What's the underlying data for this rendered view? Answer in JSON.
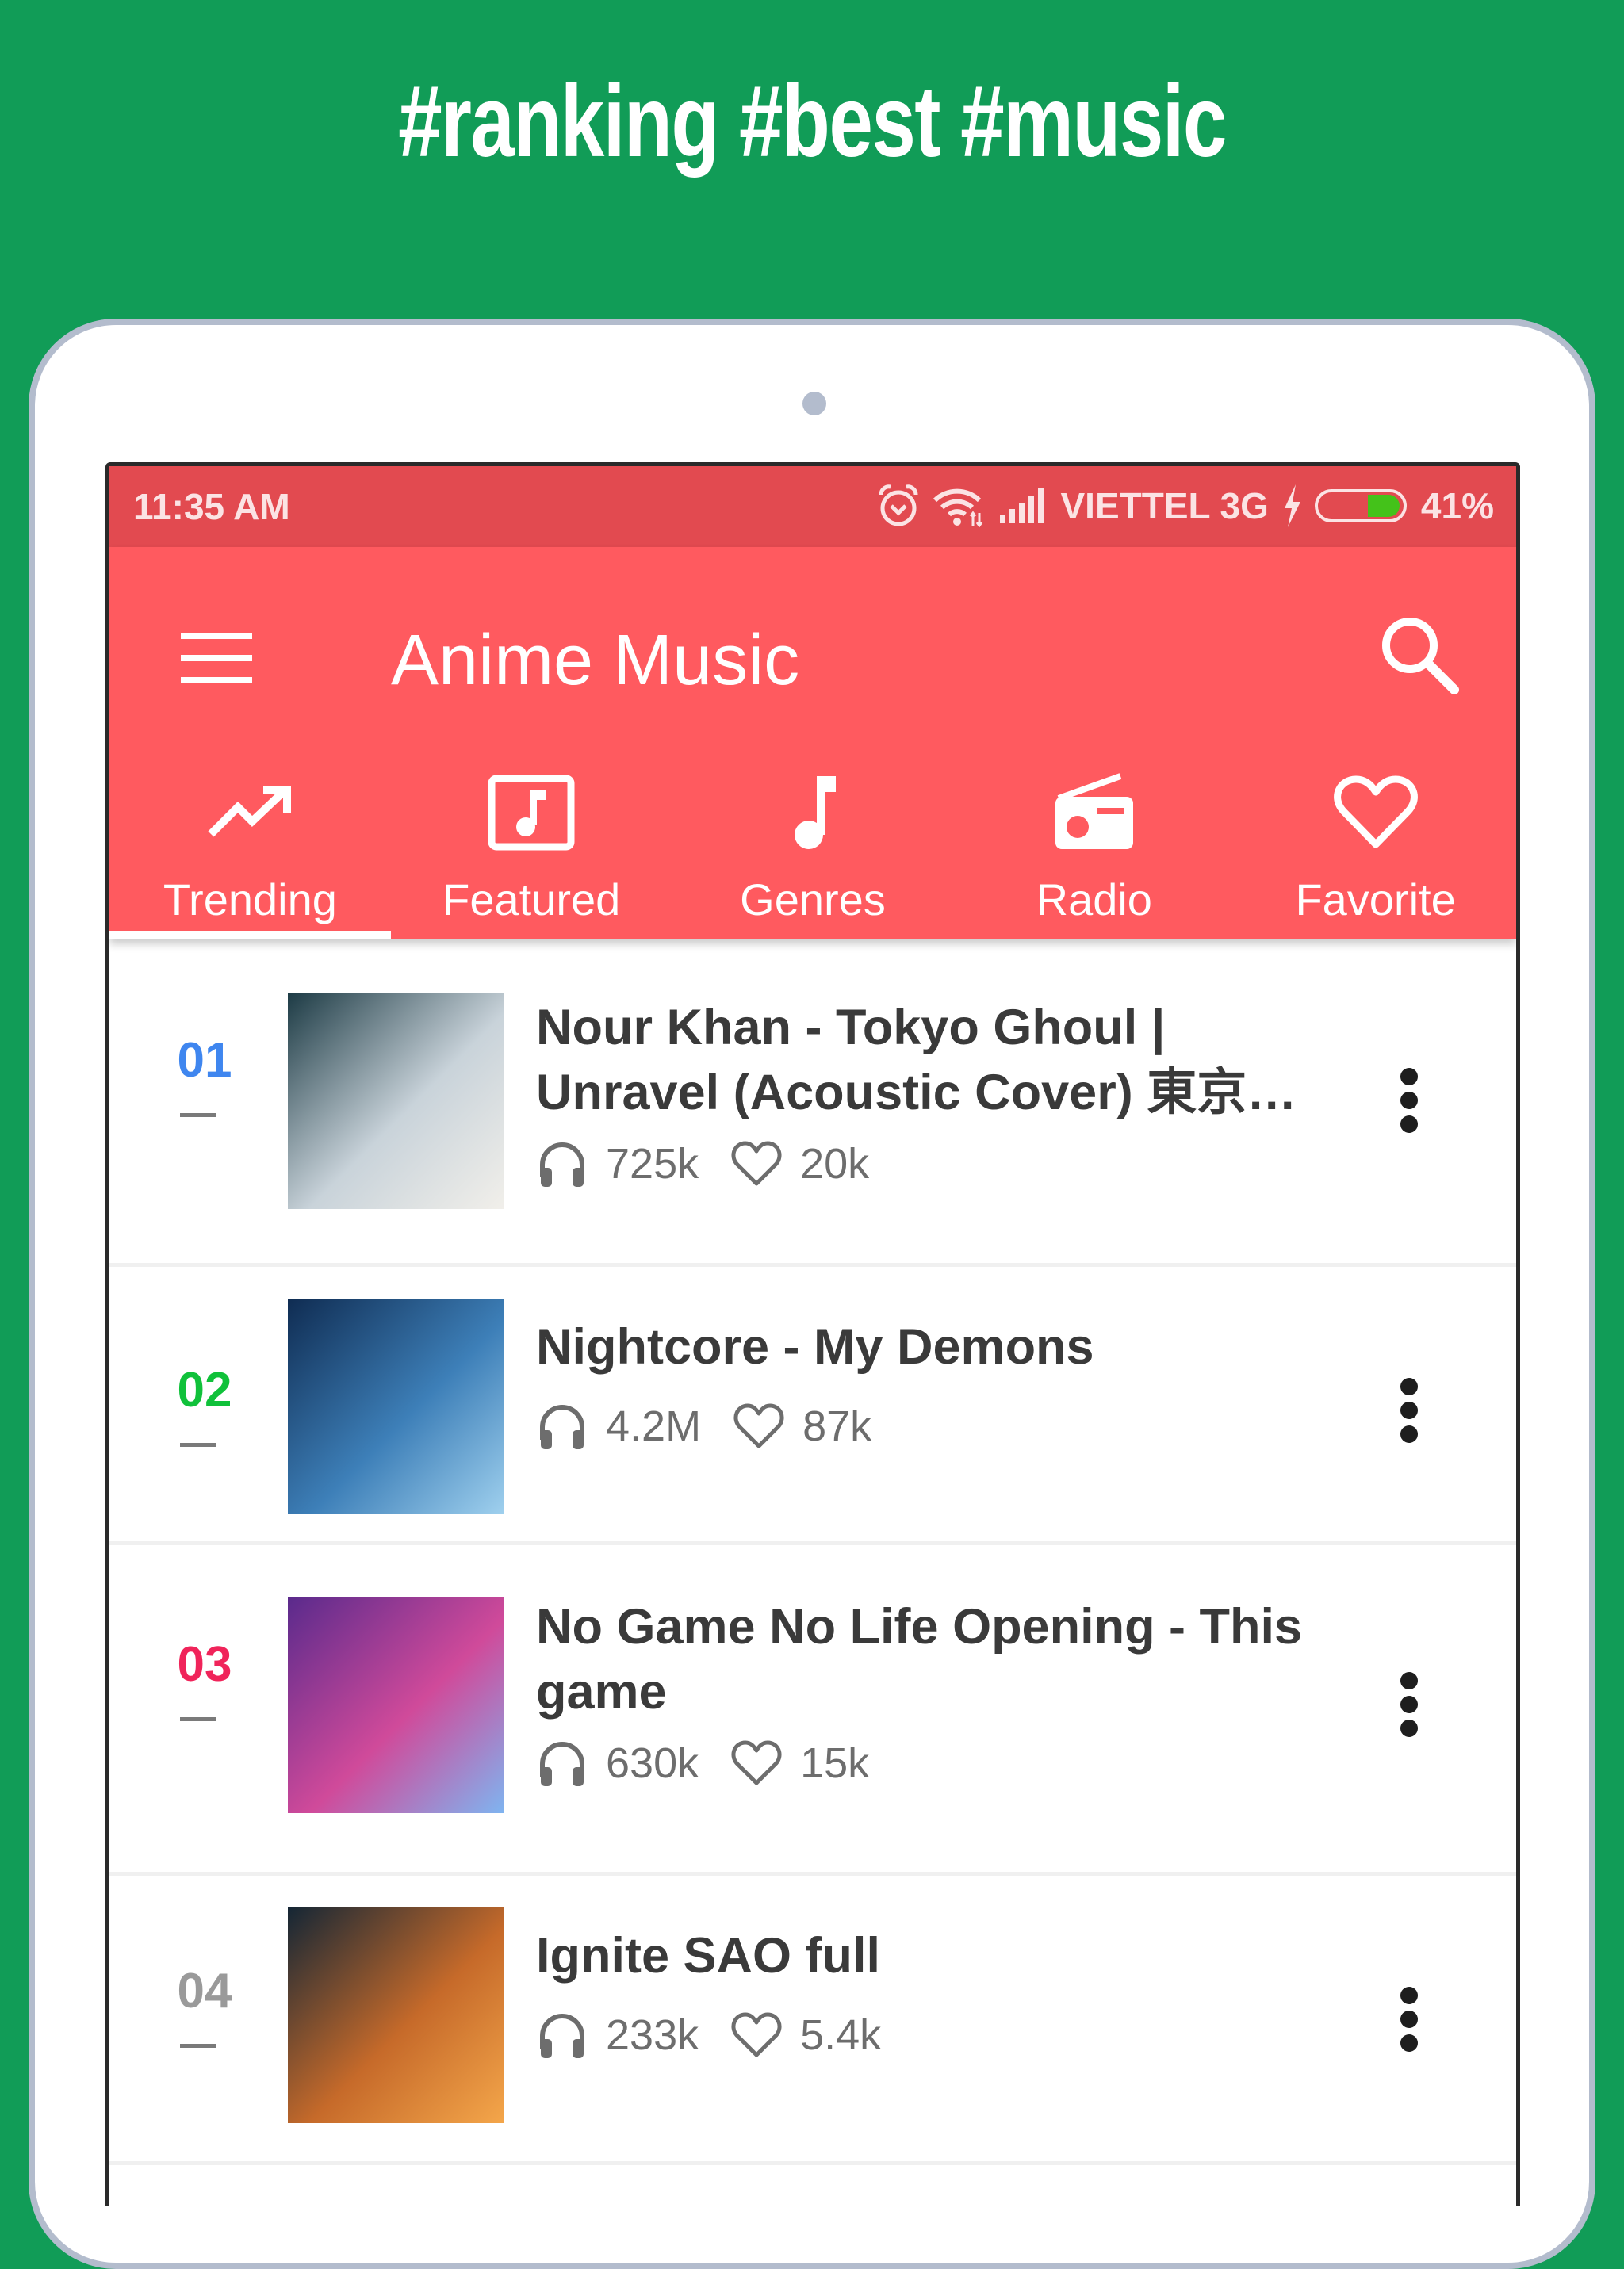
{
  "headline": "#ranking #best #music",
  "status_bar": {
    "time": "11:35 AM",
    "carrier": "VIETTEL 3G",
    "battery_percent": "41%",
    "battery_level": 0.41,
    "icons": [
      "alarm-icon",
      "wifi-icon",
      "signal-icon",
      "charging-icon",
      "battery-icon"
    ]
  },
  "app_bar": {
    "title": "Anime Music",
    "menu_icon": "hamburger-menu-icon",
    "search_icon": "search-icon"
  },
  "tabs": [
    {
      "label": "Trending",
      "icon": "trending-up-icon",
      "active": true
    },
    {
      "label": "Featured",
      "icon": "music-box-icon",
      "active": false
    },
    {
      "label": "Genres",
      "icon": "music-note-icon",
      "active": false
    },
    {
      "label": "Radio",
      "icon": "radio-icon",
      "active": false
    },
    {
      "label": "Favorite",
      "icon": "heart-outline-icon",
      "active": false
    }
  ],
  "songs": [
    {
      "rank": "01",
      "rank_color": "#3f86ef",
      "title": "Nour Khan - Tokyo Ghoul | Unravel (Acoustic Cover) 東京…",
      "plays": "725k",
      "likes": "20k",
      "thumb_colors": [
        "#1d3b45",
        "#c9d3da",
        "#f1efea"
      ]
    },
    {
      "rank": "02",
      "rank_color": "#10c13a",
      "title": "Nightcore - My Demons",
      "plays": "4.2M",
      "likes": "87k",
      "thumb_colors": [
        "#0f2c52",
        "#3d7fb8",
        "#9fd0ee"
      ]
    },
    {
      "rank": "03",
      "rank_color": "#f0245a",
      "title": "No Game No Life Opening - This game",
      "plays": "630k",
      "likes": "15k",
      "thumb_colors": [
        "#5a2a8c",
        "#d04a9a",
        "#7fb4f0"
      ]
    },
    {
      "rank": "04",
      "rank_color": "#9a9a9a",
      "title": "Ignite SAO full",
      "plays": "233k",
      "likes": "5.4k",
      "thumb_colors": [
        "#142635",
        "#c66a2a",
        "#f4a64a"
      ]
    }
  ],
  "colors": {
    "background": "#119c57",
    "status_bar": "#e24a50",
    "app_bar": "#ff5a5f",
    "battery_fill": "#44c21a"
  }
}
